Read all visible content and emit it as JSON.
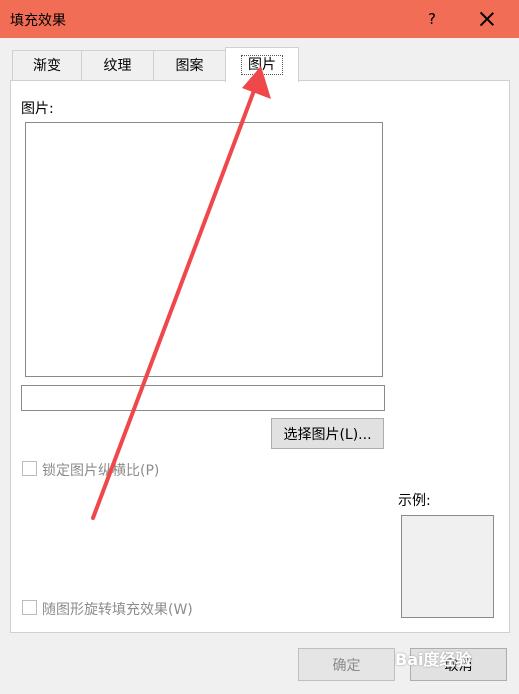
{
  "window": {
    "title": "填充效果",
    "help": "?"
  },
  "tabs": [
    {
      "label": "渐变",
      "active": false
    },
    {
      "label": "纹理",
      "active": false
    },
    {
      "label": "图案",
      "active": false
    },
    {
      "label": "图片",
      "active": true
    }
  ],
  "picture": {
    "section_label": "图片:",
    "file_value": "",
    "select_button": "选择图片(L)..."
  },
  "options": {
    "lock_aspect": {
      "label": "锁定图片纵横比(P)",
      "checked": false,
      "disabled": true
    },
    "rotate_with_shape": {
      "label": "随图形旋转填充效果(W)",
      "checked": false,
      "disabled": true
    }
  },
  "sample": {
    "label": "示例:"
  },
  "footer": {
    "ok": "确定",
    "cancel": "取消"
  },
  "watermark": "Bai度经验",
  "colors": {
    "titlebar": "#f26d55",
    "annotation_arrow": "#f0474b"
  }
}
